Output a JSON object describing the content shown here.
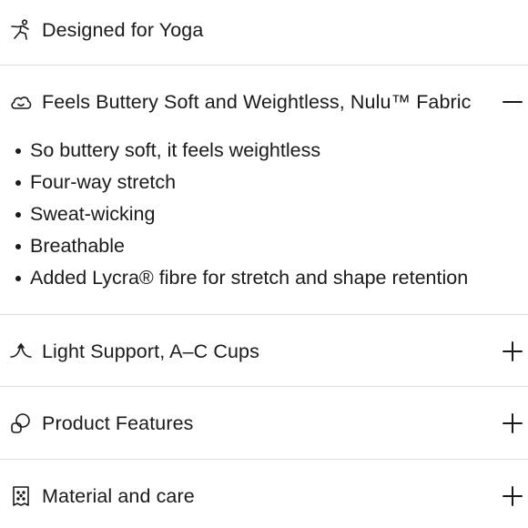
{
  "accordion": {
    "items": [
      {
        "icon": "yoga-pose-icon",
        "title": "Designed for Yoga",
        "expanded": false,
        "toggle": "none"
      },
      {
        "icon": "cloud-smile-icon",
        "title": "Feels Buttery Soft and Weightless, Nulu™ Fabric",
        "expanded": true,
        "toggle": "minus"
      },
      {
        "icon": "support-icon",
        "title": "Light Support, A–C Cups",
        "expanded": false,
        "toggle": "plus"
      },
      {
        "icon": "product-features-icon",
        "title": "Product Features",
        "expanded": false,
        "toggle": "plus"
      },
      {
        "icon": "care-label-icon",
        "title": "Material and care",
        "expanded": false,
        "toggle": "plus"
      }
    ],
    "fabric_bullets": [
      "So buttery soft, it feels weightless",
      "Four-way stretch",
      "Sweat-wicking",
      "Breathable",
      "Added Lycra® fibre for stretch and shape retention"
    ]
  },
  "colors": {
    "text": "#1a1a1a",
    "divider": "#dcdcdc",
    "background": "#ffffff"
  }
}
